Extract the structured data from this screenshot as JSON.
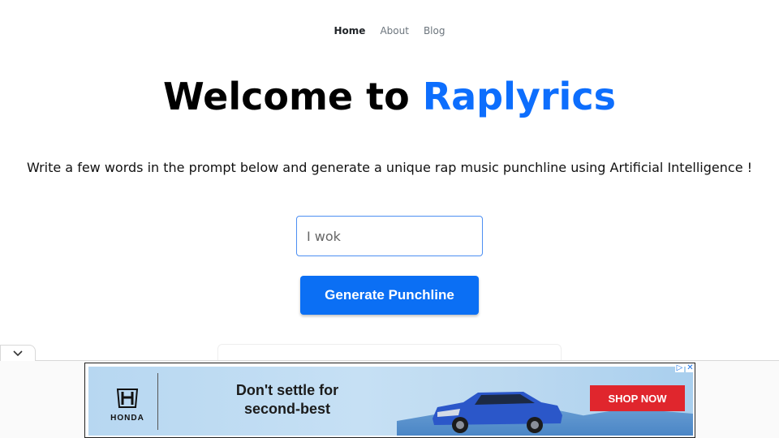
{
  "nav": {
    "items": [
      {
        "label": "Home",
        "active": true
      },
      {
        "label": "About",
        "active": false
      },
      {
        "label": "Blog",
        "active": false
      }
    ]
  },
  "hero": {
    "title_prefix": "Welcome to ",
    "title_brand": "Raplyrics",
    "subtitle": "Write a few words in the prompt below and generate a unique rap music punchline using Artificial Intelligence !"
  },
  "prompt": {
    "value": "I wok"
  },
  "generate_button": {
    "label": "Generate Punchline"
  },
  "ad": {
    "brand": "HONDA",
    "headline_line1": "Don't settle for",
    "headline_line2": "second-best",
    "cta": "SHOP NOW",
    "adchoices_glyph": "▷",
    "close_glyph": "✕"
  },
  "colors": {
    "brand_blue": "#0d6efd",
    "button_blue": "#0b6ff4",
    "cta_red": "#e0262d"
  },
  "icons": {
    "collapse": "chevron-down-icon",
    "adchoices": "adchoices-icon",
    "close": "close-icon"
  }
}
